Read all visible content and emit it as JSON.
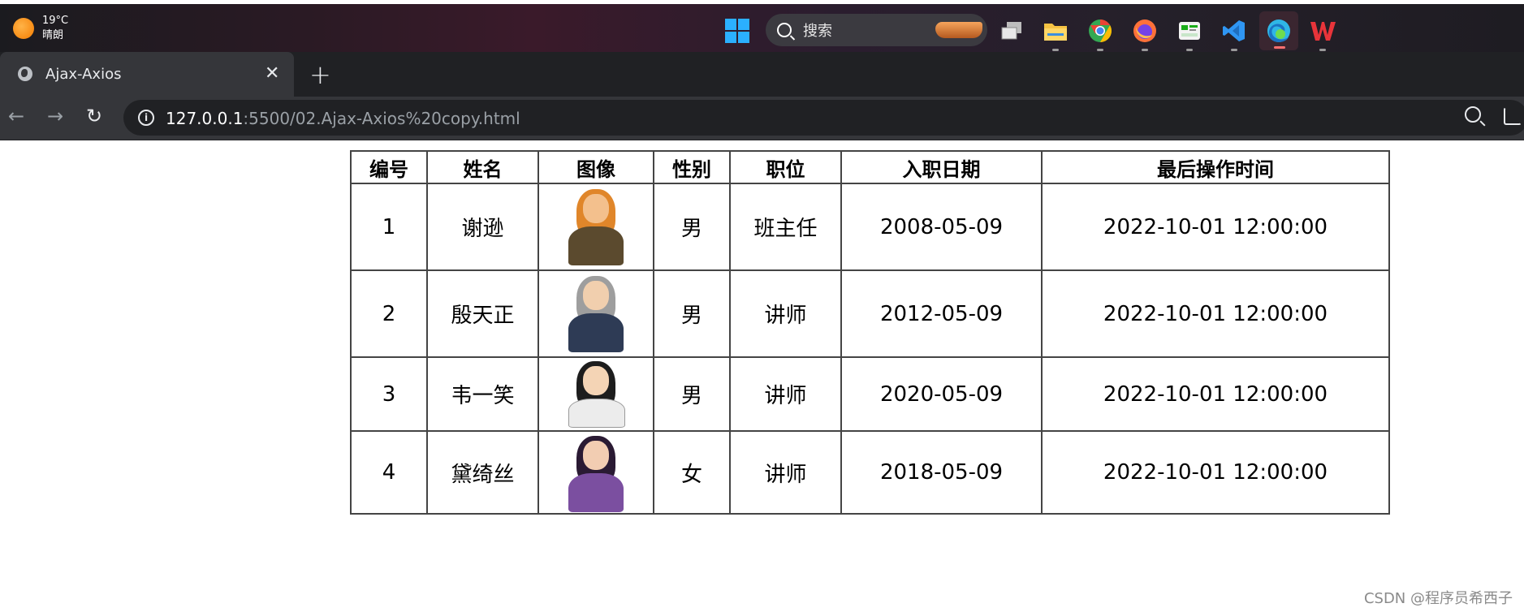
{
  "taskbar": {
    "weather_temp": "19°C",
    "weather_desc": "晴朗",
    "search_placeholder": "搜索",
    "apps": [
      {
        "name": "task-view-icon",
        "color": "#d8d8d8"
      },
      {
        "name": "file-explorer-icon",
        "color": "#f6c343"
      },
      {
        "name": "chrome-icon",
        "color": "#34a853"
      },
      {
        "name": "firefox-icon",
        "color": "#ff7139"
      },
      {
        "name": "wechat-devtools-icon",
        "color": "#1aad19"
      },
      {
        "name": "vscode-icon",
        "color": "#2f96f3"
      },
      {
        "name": "edge-icon",
        "color": "#2fb6e6"
      },
      {
        "name": "wps-icon",
        "color": "#e8343a"
      }
    ]
  },
  "browser": {
    "tab_title": "Ajax-Axios",
    "url_host": "127.0.0.1",
    "url_rest": ":5500/02.Ajax-Axios%20copy.html"
  },
  "table": {
    "headers": [
      "编号",
      "姓名",
      "图像",
      "性别",
      "职位",
      "入职日期",
      "最后操作时间"
    ],
    "rows": [
      {
        "id": "1",
        "name": "谢逊",
        "avatar": "orange-haired-warrior",
        "gender": "男",
        "job": "班主任",
        "entry_date": "2008-05-09",
        "update_time": "2022-10-01 12:00:00"
      },
      {
        "id": "2",
        "name": "殷天正",
        "avatar": "grey-haired-elder",
        "gender": "男",
        "job": "讲师",
        "entry_date": "2012-05-09",
        "update_time": "2022-10-01 12:00:00"
      },
      {
        "id": "3",
        "name": "韦一笑",
        "avatar": "black-haired-swordsman",
        "gender": "男",
        "job": "讲师",
        "entry_date": "2020-05-09",
        "update_time": "2022-10-01 12:00:00"
      },
      {
        "id": "4",
        "name": "黛绮丝",
        "avatar": "purple-robed-woman",
        "gender": "女",
        "job": "讲师",
        "entry_date": "2018-05-09",
        "update_time": "2022-10-01 12:00:00"
      }
    ]
  },
  "watermark": "CSDN @程序员希西子"
}
